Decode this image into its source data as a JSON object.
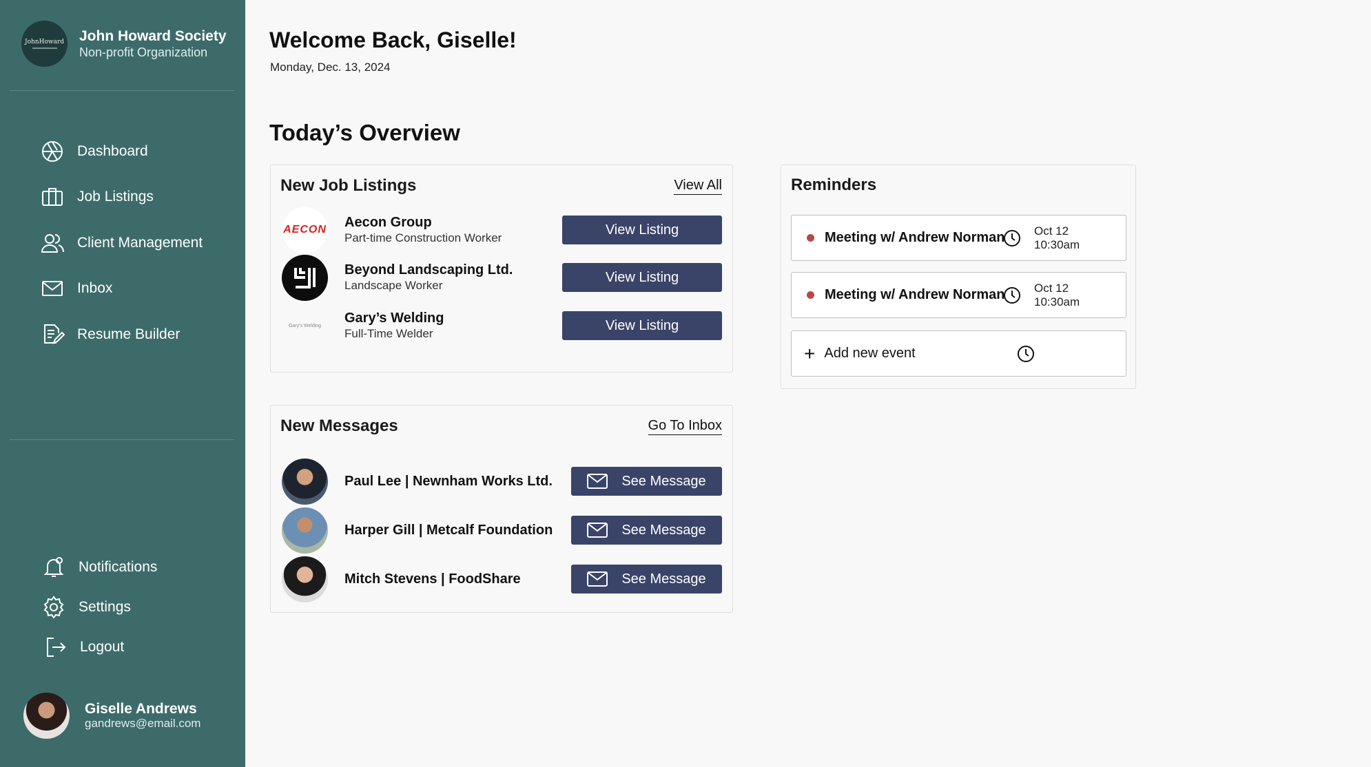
{
  "org": {
    "logo_text": "JohnHoward",
    "name": "John Howard Society",
    "subtitle": "Non-profit Organization"
  },
  "nav": {
    "main": [
      {
        "label": "Dashboard",
        "icon": "aperture-icon"
      },
      {
        "label": "Job Listings",
        "icon": "briefcase-icon"
      },
      {
        "label": "Client Management",
        "icon": "users-icon"
      },
      {
        "label": "Inbox",
        "icon": "mail-icon"
      },
      {
        "label": "Resume Builder",
        "icon": "file-edit-icon"
      }
    ],
    "bottom": [
      {
        "label": "Notifications",
        "icon": "bell-icon"
      },
      {
        "label": "Settings",
        "icon": "gear-icon"
      },
      {
        "label": "Logout",
        "icon": "logout-icon"
      }
    ]
  },
  "user": {
    "name": "Giselle Andrews",
    "email": "gandrews@email.com"
  },
  "header": {
    "welcome": "Welcome Back, Giselle!",
    "date": "Monday, Dec. 13, 2024",
    "overview": "Today’s Overview"
  },
  "jobs": {
    "title": "New Job Listings",
    "view_all": "View All",
    "button_label": "View Listing",
    "items": [
      {
        "company": "Aecon Group",
        "role": "Part-time Construction Worker",
        "logo_text": "AECON"
      },
      {
        "company": "Beyond Landscaping Ltd.",
        "role": "Landscape Worker"
      },
      {
        "company": "Gary’s Welding",
        "role": "Full-Time Welder",
        "logo_text": "Gary's Welding"
      }
    ]
  },
  "messages": {
    "title": "New Messages",
    "go_inbox": "Go To Inbox",
    "button_label": "See Message",
    "items": [
      {
        "sender": "Paul Lee | Newnham Works Ltd."
      },
      {
        "sender": "Harper Gill | Metcalf Foundation"
      },
      {
        "sender": "Mitch Stevens | FoodShare"
      }
    ]
  },
  "reminders": {
    "title": "Reminders",
    "items": [
      {
        "title": "Meeting w/ Andrew Norman",
        "date": "Oct 12",
        "time": "10:30am"
      },
      {
        "title": "Meeting w/ Andrew Norman",
        "date": "Oct 12",
        "time": "10:30am"
      }
    ],
    "add_label": "Add new event"
  },
  "colors": {
    "sidebar": "#3c6b6a",
    "button": "#3a4468",
    "reminder_dot": "#b54a45",
    "background": "#f8f8f8"
  }
}
